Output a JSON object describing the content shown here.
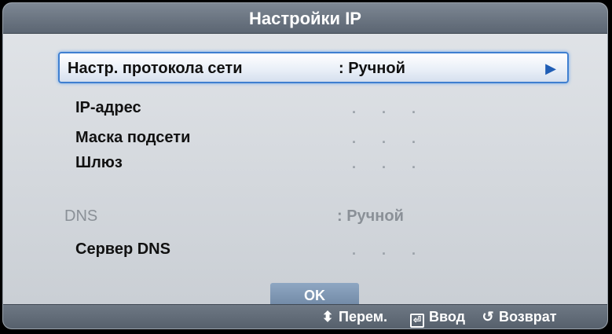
{
  "dialog": {
    "title": "Настройки IP",
    "protocol": {
      "label": "Настр. протокола сети",
      "value": ": Ручной",
      "arrow": "▶"
    },
    "ip": {
      "label": "IP-адрес",
      "value": ". . ."
    },
    "mask": {
      "label": "Маска подсети",
      "value": ". . ."
    },
    "gateway": {
      "label": "Шлюз",
      "value": ". . ."
    },
    "dns": {
      "label": "DNS",
      "value": ": Ручной"
    },
    "dns_server": {
      "label": "Сервер DNS",
      "value": ". . ."
    },
    "ok_label": "OK"
  },
  "footer": {
    "move_label": "Перем.",
    "enter_label": "Ввод",
    "back_label": "Возврат",
    "move_icon": "⬍",
    "enter_icon": "⏎",
    "back_icon": "↺"
  },
  "colors": {
    "accent": "#3f7fd0",
    "titlebar": "#6a7480",
    "panel": "#d8dce1"
  }
}
